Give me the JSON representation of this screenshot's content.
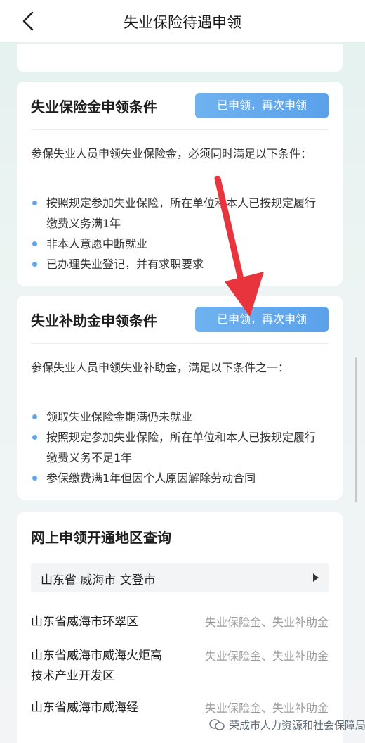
{
  "header": {
    "title": "失业保险待遇申领",
    "back_icon": "chevron-left-icon"
  },
  "unemployment_insurance": {
    "heading": "失业保险金申领条件",
    "button": "已申领，再次申领",
    "intro": "参保失业人员申领失业保险金，必须同时满足以下条件：",
    "conditions": [
      "按照规定参加失业保险，所在单位和本人已按规定履行缴费义务满1年",
      "非本人意愿中断就业",
      "已办理失业登记，并有求职要求"
    ]
  },
  "unemployment_subsidy": {
    "heading": "失业补助金申领条件",
    "button": "已申领，再次申领",
    "intro": "参保失业人员申领失业补助金，满足以下条件之一：",
    "conditions": [
      "领取失业保险金期满仍未就业",
      "按照规定参加失业保险，所在单位和本人已按规定履行缴费义务不足1年",
      "参保缴费满1年但因个人原因解除劳动合同"
    ]
  },
  "online_regions": {
    "heading": "网上申领开通地区查询",
    "selected_region": "山东省 威海市 文登市",
    "rows": [
      {
        "name": "山东省威海市环翠区",
        "types": "失业保险金、失业补助金"
      },
      {
        "name": "山东省威海市威海火炬高技术产业开发区",
        "types": "失业保险金、失业补助金"
      },
      {
        "name": "山东省威海市威海经",
        "types": "失业保险金、失业补助金"
      }
    ]
  },
  "watermark": {
    "text": "荣成市人力资源和社会保障局",
    "icon": "wechat-icon"
  },
  "colors": {
    "accent": "#5fa6ea",
    "arrow": "#e8343c"
  }
}
